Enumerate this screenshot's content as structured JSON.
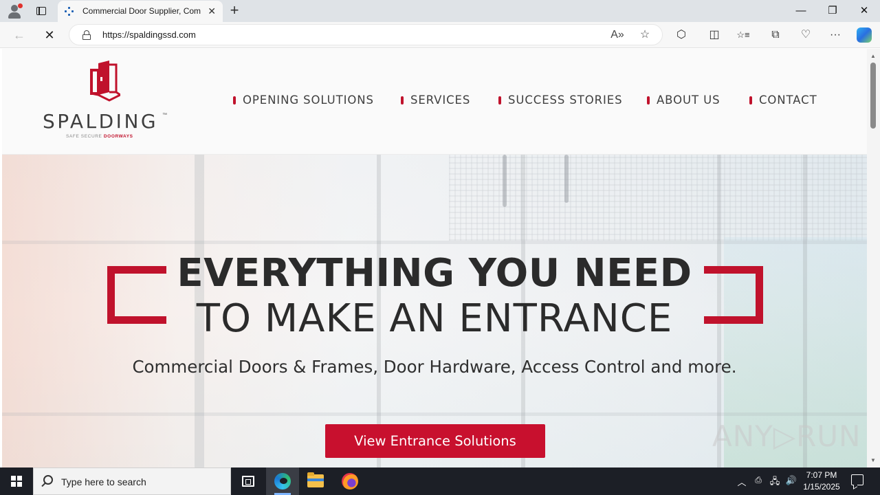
{
  "browser": {
    "tab": {
      "title": "Commercial Door Supplier, Com",
      "close_glyph": "✕"
    },
    "new_tab_glyph": "+",
    "window": {
      "minimize": "—",
      "maximize": "❐",
      "close": "✕"
    },
    "nav": {
      "back": "←",
      "stop": "✕"
    },
    "url": "https://spaldingssd.com",
    "icons": {
      "read_aloud": "A»",
      "favorite": "☆",
      "extensions": "⬡",
      "split_screen": "◫",
      "favorites": "☆≡",
      "collections": "⧉",
      "performance": "♡",
      "more": "···"
    }
  },
  "site": {
    "logo": {
      "wordmark": "SPALDING",
      "tm": "™",
      "tagline_prefix": "SAFE SECURE ",
      "tagline_highlight": "DOORWAYS"
    },
    "nav": [
      {
        "label": "OPENING SOLUTIONS"
      },
      {
        "label": "SERVICES"
      },
      {
        "label": "SUCCESS STORIES"
      },
      {
        "label": "ABOUT US"
      },
      {
        "label": "CONTACT"
      }
    ],
    "hero": {
      "headline_line1": "EVERYTHING YOU NEED",
      "headline_line2": "TO MAKE AN ENTRANCE",
      "subheadline": "Commercial Doors & Frames, Door Hardware, Access Control and more.",
      "cta_label": "View Entrance Solutions"
    },
    "watermark": "ANY▷RUN"
  },
  "colors": {
    "brand_red": "#c8102e",
    "text_dark": "#2b2b2b"
  },
  "taskbar": {
    "search_placeholder": "Type here to search",
    "tray": {
      "chevron": "︿",
      "volume": "🔊",
      "network": "🖧"
    },
    "clock": {
      "time": "7:07 PM",
      "date": "1/15/2025"
    }
  }
}
